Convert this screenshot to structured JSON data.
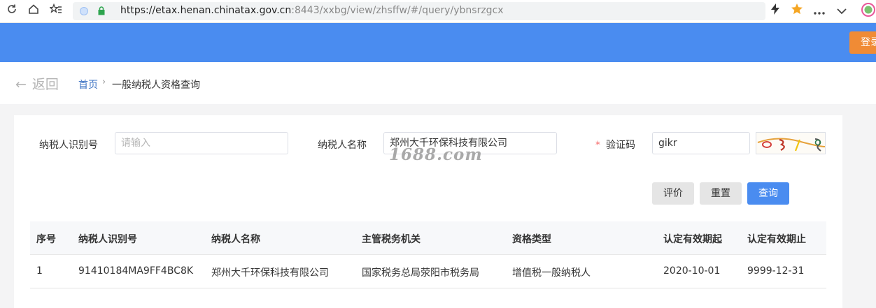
{
  "browser": {
    "url_host": "https://etax.henan.chinatax.gov.cn",
    "url_path": ":8443/xxbg/view/zhsffw/#/query/ybnsrzgcx",
    "icons": [
      "reload-icon",
      "home-icon",
      "favorites-icon",
      "lightning-icon",
      "star-icon",
      "more-icon",
      "chevron-down-icon",
      "profile-icon"
    ]
  },
  "header": {
    "login_label": "登录",
    "accent": "#4a8cf0"
  },
  "nav": {
    "back_label": "返回",
    "breadcrumb_home": "首页",
    "breadcrumb_sep": "›",
    "breadcrumb_current": "一般纳税人资格查询"
  },
  "form": {
    "taxpayer_id_label": "纳税人识别号",
    "taxpayer_id_placeholder": "请输入",
    "taxpayer_name_label": "纳税人名称",
    "taxpayer_name_value": "郑州大千环保科技有限公司",
    "required_mark": "*",
    "captcha_label": "验证码",
    "captcha_value": "gikr"
  },
  "watermark": "1688.com",
  "buttons": {
    "evaluate": "评价",
    "reset": "重置",
    "query": "查询"
  },
  "table": {
    "headers": [
      "序号",
      "纳税人识别号",
      "纳税人名称",
      "主管税务机关",
      "资格类型",
      "认定有效期起",
      "认定有效期止"
    ],
    "rows": [
      [
        "1",
        "91410184MA9FF4BC8K",
        "郑州大千环保科技有限公司",
        "国家税务总局荥阳市税务局",
        "增值税一般纳税人",
        "2020-10-01",
        "9999-12-31"
      ]
    ]
  }
}
